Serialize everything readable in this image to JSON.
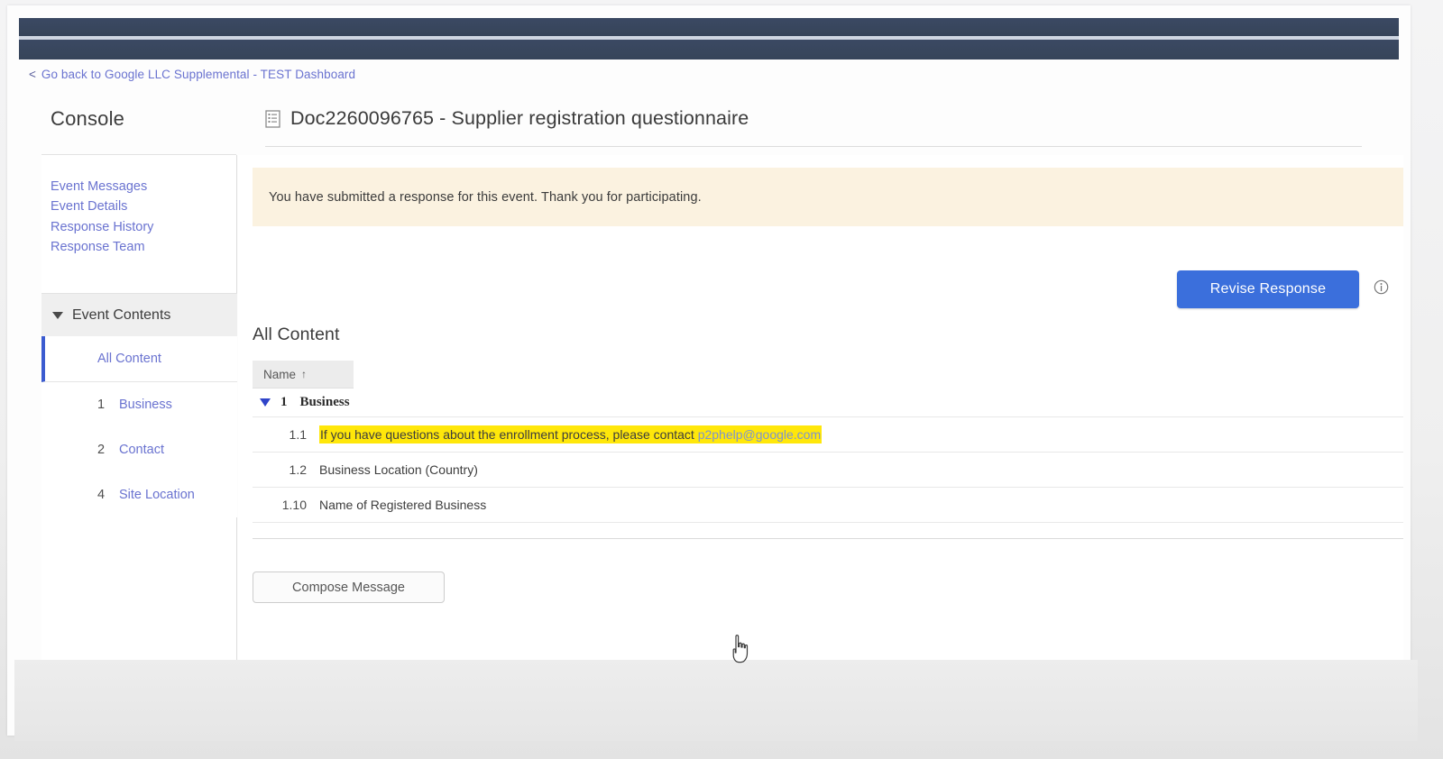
{
  "breadcrumb": {
    "chevron": "<",
    "label": "Go back to Google LLC Supplemental - TEST Dashboard"
  },
  "header": {
    "console_label": "Console",
    "doc_icon": "document-list-icon",
    "doc_title": "Doc2260096765 - Supplier registration questionnaire"
  },
  "sidebar": {
    "links": [
      {
        "label": "Event Messages"
      },
      {
        "label": "Event Details"
      },
      {
        "label": "Response History"
      },
      {
        "label": "Response Team"
      }
    ],
    "event_contents": {
      "caret": "caret-down-icon",
      "label": "Event Contents"
    },
    "subitems": [
      {
        "num": "",
        "label": "All Content",
        "selected": true
      },
      {
        "num": "1",
        "label": "Business",
        "selected": false
      },
      {
        "num": "2",
        "label": "Contact",
        "selected": false
      },
      {
        "num": "4",
        "label": "Site Location",
        "selected": false
      }
    ]
  },
  "main": {
    "banner": {
      "text": "You have submitted a response for this event.  Thank you for participating."
    },
    "revise_button_label": "Revise Response",
    "info_icon": "info-circle-icon",
    "all_content_heading": "All Content",
    "table": {
      "column_header": "Name",
      "sort_arrow": "↑",
      "rows": [
        {
          "kind": "group",
          "num": "1",
          "name": "Business"
        },
        {
          "kind": "item",
          "num": "1.1",
          "name": "If you have questions about the enrollment process, please contact ",
          "email": "p2phelp@google.com",
          "highlighted": true
        },
        {
          "kind": "item",
          "num": "1.2",
          "name": "Business Location (Country)",
          "highlighted": false
        },
        {
          "kind": "item",
          "num": "1.10",
          "name": "Name of Registered Business",
          "highlighted": false
        }
      ]
    },
    "compose_button_label": "Compose Message"
  },
  "colors": {
    "navy_bar": "#3b4963",
    "link_purple": "#6a73d0",
    "primary_button": "#3b6fdc",
    "banner_bg": "#fbf2e0",
    "highlight_yellow": "#ffe70a",
    "selected_accent": "#3b5bd0",
    "email_link": "#7e94cf"
  }
}
